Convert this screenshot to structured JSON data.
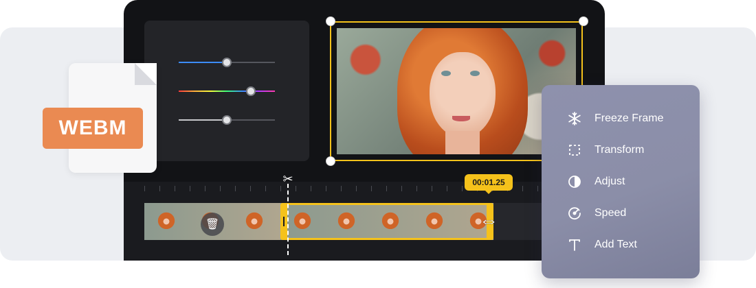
{
  "file_badge": {
    "label": "WEBM"
  },
  "timeline": {
    "timecode": "00:01.25"
  },
  "menu": {
    "items": [
      {
        "label": "Freeze Frame",
        "icon": "snowflake-icon"
      },
      {
        "label": "Transform",
        "icon": "transform-icon"
      },
      {
        "label": "Adjust",
        "icon": "contrast-icon"
      },
      {
        "label": "Speed",
        "icon": "speedometer-icon"
      },
      {
        "label": "Add Text",
        "icon": "text-icon"
      }
    ]
  },
  "colors": {
    "accent": "#f5c21b",
    "badge": "#ea8a52",
    "editor_bg": "#121316"
  },
  "sliders": [
    {
      "name": "slider-blue",
      "value": 0.5
    },
    {
      "name": "slider-hue",
      "value": 0.75
    },
    {
      "name": "slider-gray",
      "value": 0.5
    }
  ]
}
